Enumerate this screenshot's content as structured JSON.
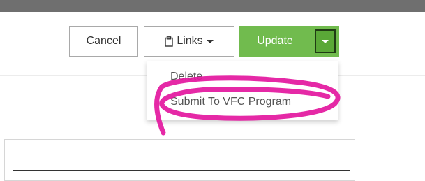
{
  "toolbar": {
    "cancel_label": "Cancel",
    "links_label": "Links",
    "links_icon": "clipboard-icon",
    "update_label": "Update",
    "colors": {
      "update_green": "#71bb4e",
      "top_bar": "#6f6f6f"
    }
  },
  "dropdown": {
    "items": [
      {
        "label": "Delete"
      },
      {
        "label": "Submit To VFC Program"
      }
    ]
  },
  "annotation": {
    "color": "#e3179e"
  }
}
